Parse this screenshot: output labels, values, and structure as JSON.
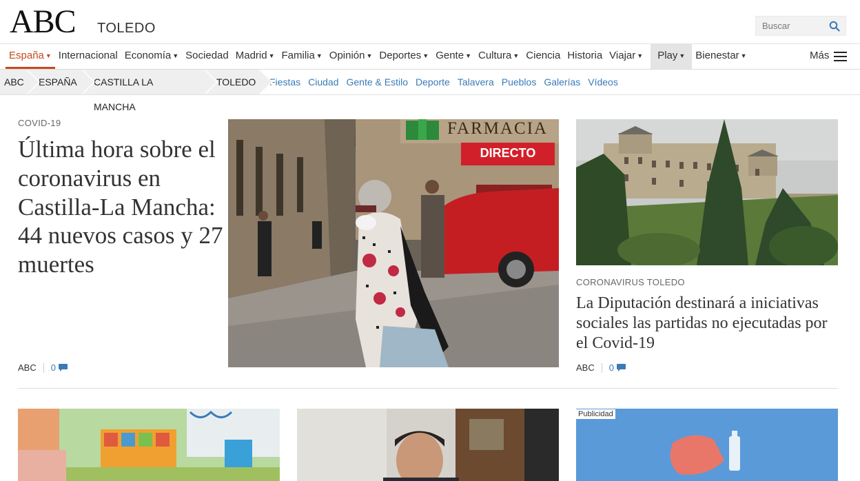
{
  "header": {
    "logo": "ABC",
    "section": "TOLEDO",
    "search_placeholder": "Buscar"
  },
  "nav": {
    "items": [
      {
        "label": "España",
        "dropdown": true,
        "active": true
      },
      {
        "label": "Internacional",
        "dropdown": false
      },
      {
        "label": "Economía",
        "dropdown": true
      },
      {
        "label": "Sociedad",
        "dropdown": false
      },
      {
        "label": "Madrid",
        "dropdown": true
      },
      {
        "label": "Familia",
        "dropdown": true
      },
      {
        "label": "Opinión",
        "dropdown": true
      },
      {
        "label": "Deportes",
        "dropdown": true
      },
      {
        "label": "Gente",
        "dropdown": true
      },
      {
        "label": "Cultura",
        "dropdown": true
      },
      {
        "label": "Ciencia",
        "dropdown": false
      },
      {
        "label": "Historia",
        "dropdown": false
      },
      {
        "label": "Viajar",
        "dropdown": true
      },
      {
        "label": "Play",
        "dropdown": true,
        "highlight": true
      },
      {
        "label": "Bienestar",
        "dropdown": true
      }
    ],
    "more": "Más"
  },
  "breadcrumb": {
    "items": [
      "ABC",
      "ESPAÑA",
      "CASTILLA LA MANCHA",
      "TOLEDO"
    ],
    "sublinks": [
      "Fiestas",
      "Ciudad",
      "Gente & Estilo",
      "Deporte",
      "Talavera",
      "Pueblos",
      "Galerías",
      "Vídeos"
    ]
  },
  "feature": {
    "kicker": "COVID-19",
    "headline": "Última hora sobre el coronavirus en Castilla-La Mancha: 44 nuevos casos y 27 muertes",
    "author": "ABC",
    "comments": "0",
    "photo_sign_pharmacy": "FARMACIA",
    "photo_sign_live": "DIRECTO"
  },
  "side_story": {
    "kicker": "CORONAVIRUS TOLEDO",
    "headline": "La Diputación destinará a iniciativas sociales las partidas no ejecutadas por el Covid-19",
    "author": "ABC",
    "comments": "0"
  },
  "ad": {
    "label": "Publicidad"
  },
  "colors": {
    "accent": "#c64a1e",
    "link": "#3a7ab8",
    "headline": "#333333"
  }
}
